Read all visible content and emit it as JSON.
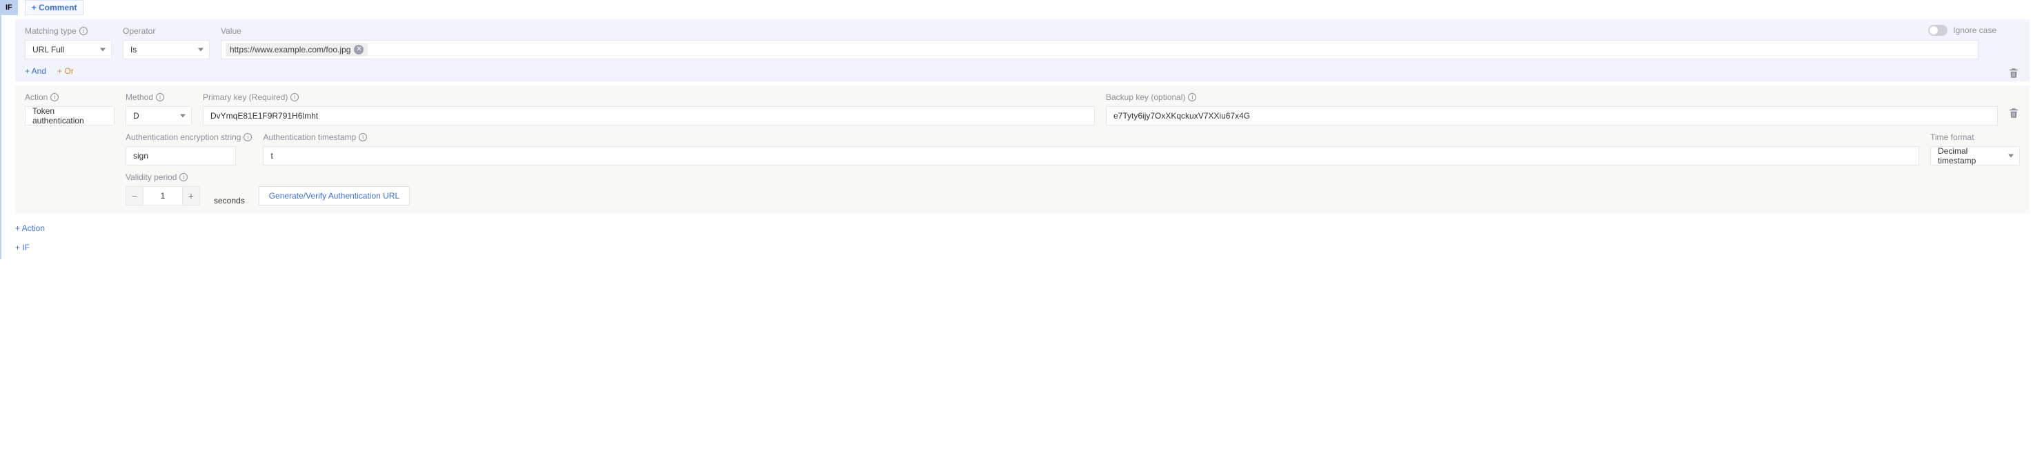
{
  "header": {
    "if_label": "IF",
    "comment_plus": "+",
    "comment_label": "Comment"
  },
  "condition": {
    "labels": {
      "matching_type": "Matching type",
      "operator": "Operator",
      "value": "Value",
      "ignore_case": "Ignore case"
    },
    "matching_type": "URL Full",
    "operator": "Is",
    "chip_value": "https://www.example.com/foo.jpg",
    "ignore_case_on": false,
    "andor": {
      "and": "+ And",
      "or": "+ Or"
    }
  },
  "action": {
    "labels": {
      "action": "Action",
      "method": "Method",
      "primary_key": "Primary key (Required)",
      "backup_key": "Backup key (optional)",
      "auth_enc_string": "Authentication encryption string",
      "auth_timestamp": "Authentication timestamp",
      "time_format": "Time format",
      "validity_period": "Validity period"
    },
    "action_value": "Token authentication",
    "method_value": "D",
    "primary_key": "DvYmqE81E1F9R791H6lmht",
    "backup_key": "e7Tyty6ijy7OxXKqckuxV7XXiu67x4G",
    "auth_enc_string": "sign",
    "auth_timestamp": "t",
    "time_format": "Decimal timestamp",
    "validity_period_value": "1",
    "validity_period_unit": "seconds",
    "generate_label": "Generate/Verify Authentication URL"
  },
  "footer": {
    "add_action": "+ Action",
    "add_if": "+ IF"
  }
}
